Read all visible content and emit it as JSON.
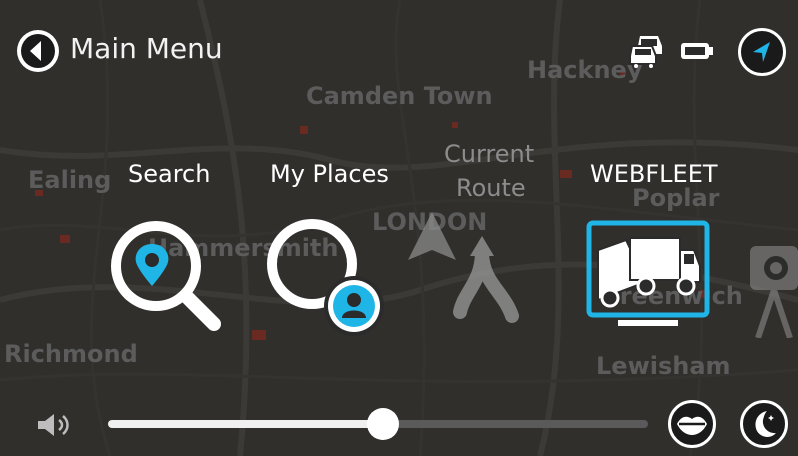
{
  "header": {
    "title": "Main Menu",
    "back_icon": "back-arrow-icon",
    "traffic_icon": "traffic-cars-icon",
    "battery_icon": "battery-icon",
    "current_location_icon": "navigation-arrow-icon"
  },
  "map_labels": {
    "hackney": "Hackney",
    "camden": "Camden Town",
    "ealing": "Ealing",
    "poplar": "Poplar",
    "london": "LONDON",
    "hammersmith": "Hammersmith",
    "greenwich": "Greenwich",
    "richmond": "Richmond",
    "lewisham": "Lewisham"
  },
  "menu": {
    "items": [
      {
        "label": "Search",
        "icon": "search-icon",
        "state": "active"
      },
      {
        "label": "My Places",
        "icon": "my-places-icon",
        "state": "active"
      },
      {
        "label_line1": "Current",
        "label_line2": "Route",
        "icon": "current-route-icon",
        "state": "disabled"
      },
      {
        "label": "WEBFLEET",
        "icon": "webfleet-truck-icon",
        "state": "selected"
      }
    ],
    "partial_icon": "speed-camera-icon"
  },
  "footer": {
    "volume_icon": "speaker-icon",
    "volume_level": 0.51,
    "voice_icon": "lips-icon",
    "night_mode_icon": "moon-icon"
  },
  "colors": {
    "accent": "#1fb5e6",
    "text": "#ffffff",
    "disabled_text": "#8c8c8c",
    "map_label": "#5c5c5c",
    "slider_track": "#5a5a5a",
    "slider_fill": "#f0f0f0"
  }
}
